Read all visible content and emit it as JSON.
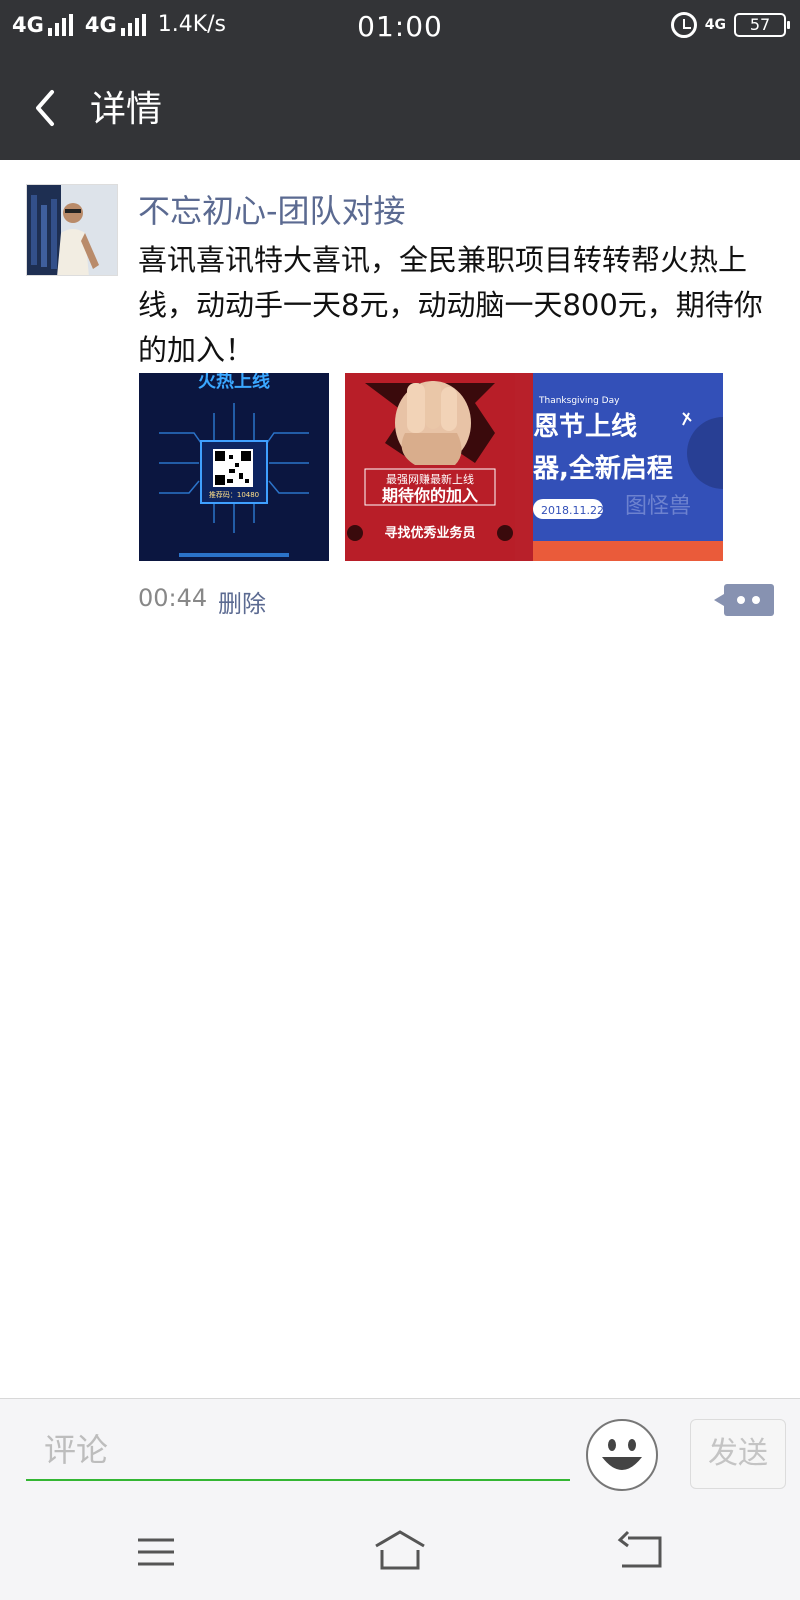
{
  "status_bar": {
    "network1": "4G",
    "network2": "4G",
    "speed": "1.4K/s",
    "time": "01:00",
    "network_small": "4G",
    "battery": "57"
  },
  "header": {
    "title": "详情"
  },
  "post": {
    "author": "不忘初心-团队对接",
    "text": "喜讯喜讯特大喜讯，全民兼职项目转转帮火热上线，动动手一天8元，动动脑一天800元，期待你的加入！",
    "time": "00:44",
    "delete_label": "删除",
    "images": [
      {
        "headline": "火热上线",
        "caption": "推荐码：10480"
      },
      {
        "line1": "最强网赚最新上线",
        "line2": "期待你的加入",
        "line3": "寻找优秀业务员"
      },
      {
        "small": "Thanksgiving Day",
        "line1": "恩节上线",
        "line2": "器,全新启程",
        "date": "2018.11.22",
        "watermark": "图怪兽"
      }
    ]
  },
  "comment_bar": {
    "placeholder": "评论",
    "send_label": "发送"
  },
  "colors": {
    "header_bg": "#333437",
    "author_link": "#5b6a91",
    "input_underline": "#33b633"
  }
}
